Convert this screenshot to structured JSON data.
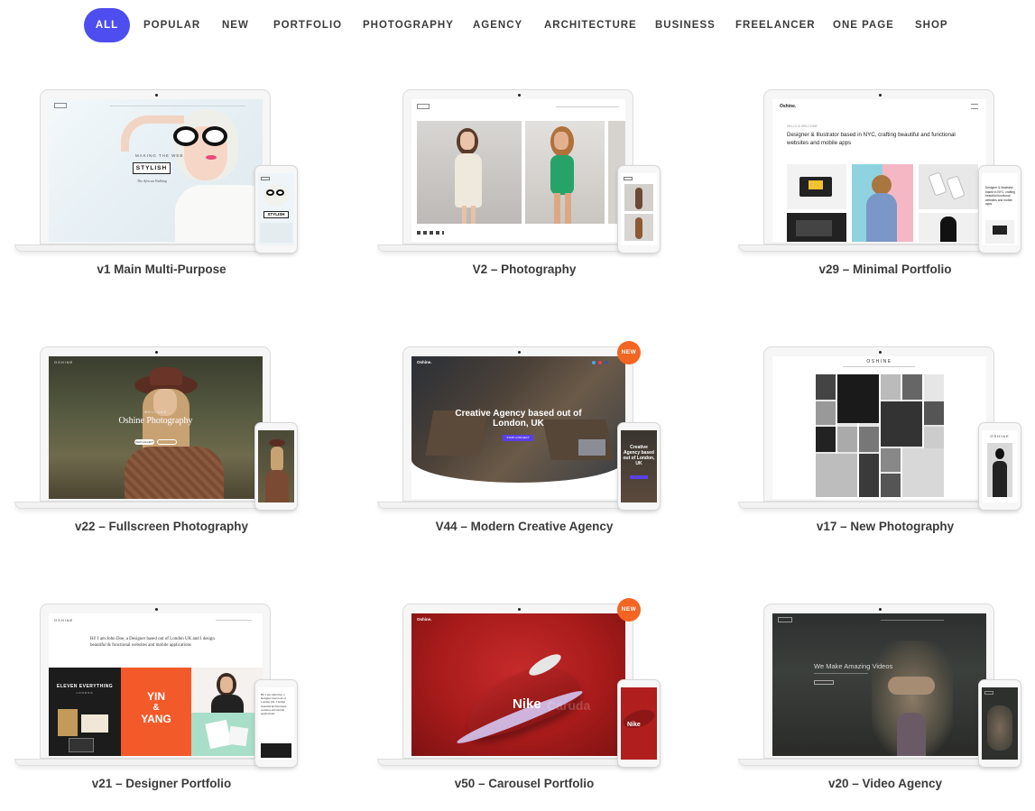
{
  "filters": [
    {
      "label": "ALL",
      "active": true
    },
    {
      "label": "POPULAR"
    },
    {
      "label": "NEW"
    },
    {
      "label": "PORTFOLIO"
    },
    {
      "label": "PHOTOGRAPHY"
    },
    {
      "label": "AGENCY"
    },
    {
      "label": "ARCHITECTURE"
    },
    {
      "label": "BUSINESS"
    },
    {
      "label": "FREELANCER"
    },
    {
      "label": "ONE PAGE"
    },
    {
      "label": "SHOP"
    }
  ],
  "demos": [
    {
      "title": "v1 Main Multi-Purpose",
      "screen": {
        "stamp": "STYLISH",
        "eyebrow": "MAKING THE WEB",
        "caption": "The African Walking",
        "phone_stamp": "STYLISH"
      }
    },
    {
      "title": "V2 – Photography"
    },
    {
      "title": "v29 – Minimal Portfolio",
      "screen": {
        "brand": "Oshine.",
        "tag": "HELLO & WELCOME",
        "headline": "Designer & Illustrator based in NYC, crafting beautiful and functional websites and mobile apps",
        "phone_headline": "Designer & Illustrator based in NYC, crafting beautiful functional websites and mobile apps"
      }
    },
    {
      "title": "v22 – Fullscreen Photography",
      "screen": {
        "brand": "OSHINE",
        "welcome": "WELCOME",
        "headline": "Oshine Photography",
        "button": "VIEW GALLERY"
      }
    },
    {
      "title": "V44 – Modern Creative Agency",
      "badge": "NEW",
      "screen": {
        "brand": "Oshine.",
        "headline": "Creative Agency based out of London, UK",
        "button": "START A PROJECT",
        "phone_headline": "Creative Agency based out of London, UK"
      }
    },
    {
      "title": "v17 – New Photography",
      "screen": {
        "brand": "OSHINE",
        "phone_brand": "OSHINE"
      }
    },
    {
      "title": "v21 – Designer Portfolio",
      "screen": {
        "brand": "OSHINE",
        "headline": "Hi! I am John Doe, a Designer based out of London UK and I design beautiful & functional websites and mobile applications",
        "panel_text": "ELEVEN EVERYTHING",
        "panel_sub": "LONDON",
        "yin": "YIN",
        "amp": "&",
        "yang": "YANG",
        "phone_headline": "Hi! I am John Doe, a Designer based out of London UK, I design beautiful & functional websites and mobile applications"
      }
    },
    {
      "title": "v50 – Carousel Portfolio",
      "badge": "NEW",
      "screen": {
        "brand": "Oshine.",
        "product": "Nike",
        "ghost": "Caruda",
        "phone_product": "Nike"
      }
    },
    {
      "title": "v20 – Video Agency",
      "screen": {
        "headline": "We Make Amazing Videos"
      }
    }
  ],
  "colors": {
    "accent": "#4d4df0",
    "badge": "#f26522",
    "title_text": "#3b3b3b",
    "filter_text": "#3c3c3c"
  }
}
